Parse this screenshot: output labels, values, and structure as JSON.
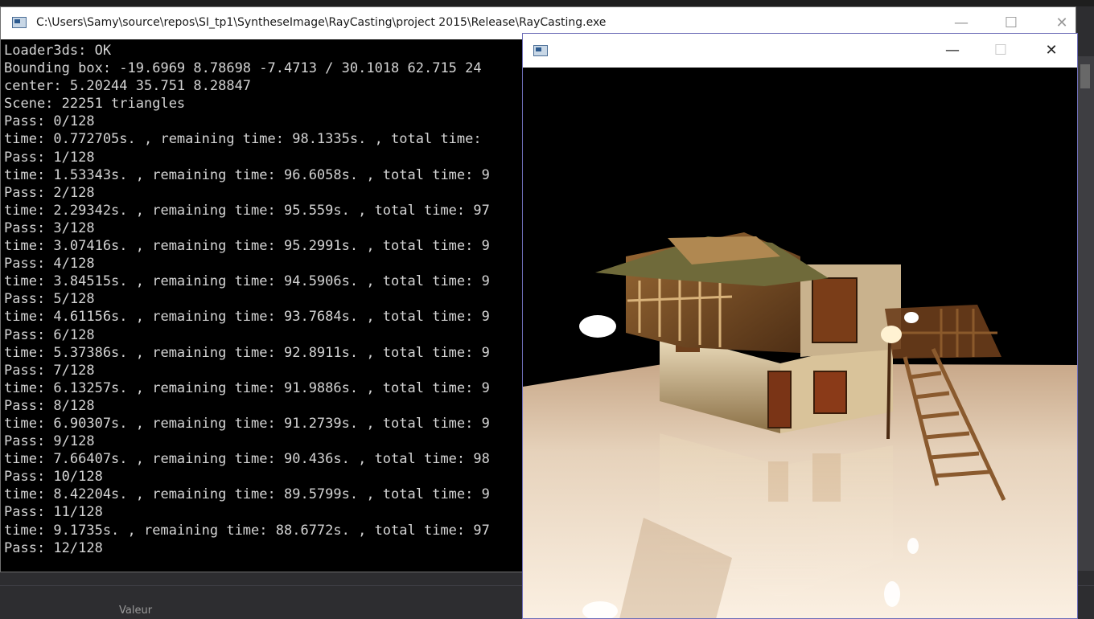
{
  "console_window": {
    "title": "C:\\Users\\Samy\\source\\repos\\SI_tp1\\SyntheseImage\\RayCasting\\project 2015\\Release\\RayCasting.exe",
    "controls": {
      "minimize": "—",
      "maximize": "☐",
      "close": "✕"
    },
    "lines": [
      "Loader3ds: OK",
      "Bounding box: -19.6969 8.78698 -7.4713 / 30.1018 62.715 24",
      "center: 5.20244 35.751 8.28847",
      "Scene: 22251 triangles",
      "Pass: 0/128",
      "time: 0.772705s. , remaining time: 98.1335s. , total time:",
      "Pass: 1/128",
      "time: 1.53343s. , remaining time: 96.6058s. , total time: 9",
      "Pass: 2/128",
      "time: 2.29342s. , remaining time: 95.559s. , total time: 97",
      "Pass: 3/128",
      "time: 3.07416s. , remaining time: 95.2991s. , total time: 9",
      "Pass: 4/128",
      "time: 3.84515s. , remaining time: 94.5906s. , total time: 9",
      "Pass: 5/128",
      "time: 4.61156s. , remaining time: 93.7684s. , total time: 9",
      "Pass: 6/128",
      "time: 5.37386s. , remaining time: 92.8911s. , total time: 9",
      "Pass: 7/128",
      "time: 6.13257s. , remaining time: 91.9886s. , total time: 9",
      "Pass: 8/128",
      "time: 6.90307s. , remaining time: 91.2739s. , total time: 9",
      "Pass: 9/128",
      "time: 7.66407s. , remaining time: 90.436s. , total time: 98",
      "Pass: 10/128",
      "time: 8.42204s. , remaining time: 89.5799s. , total time: 9",
      "Pass: 11/128",
      "time: 9.1735s. , remaining time: 88.6772s. , total time: 97",
      "Pass: 12/128"
    ]
  },
  "render_window": {
    "controls": {
      "minimize": "—",
      "maximize": "☐",
      "close": "✕"
    }
  },
  "ide": {
    "column_label": "Valeur"
  },
  "colors": {
    "console_bg": "#000000",
    "console_text": "#d4d4d4",
    "render_border": "#6e6eb8",
    "floor_light": "#fbf0e2"
  }
}
